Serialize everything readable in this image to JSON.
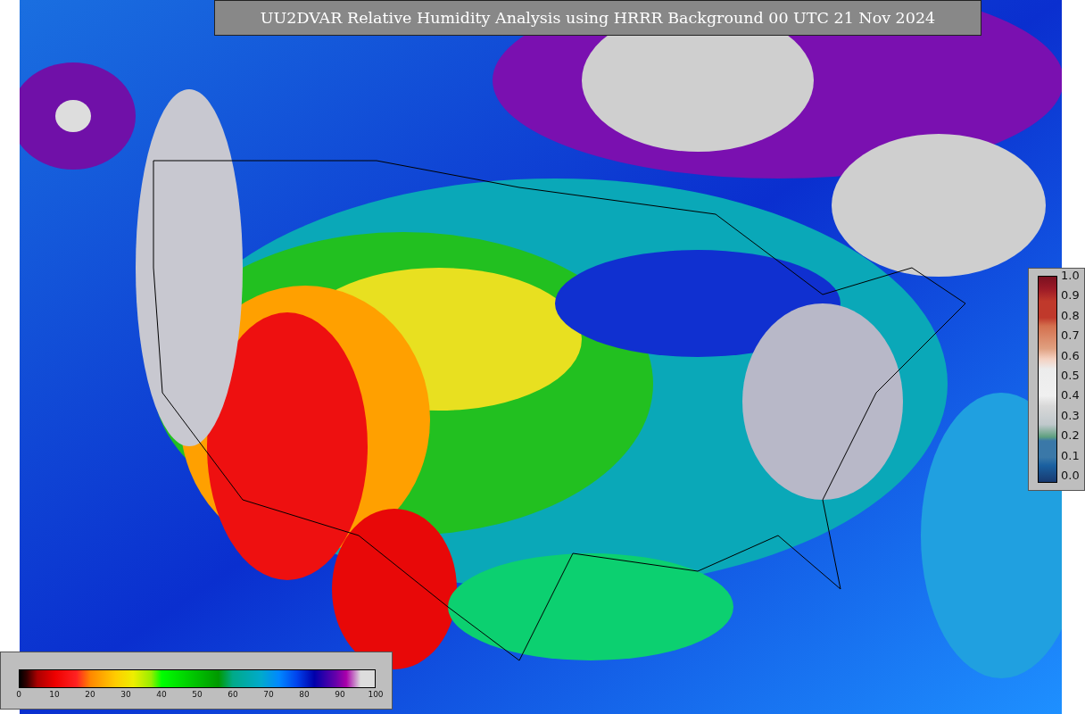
{
  "title": "UU2DVAR Relative Humidity Analysis using HRRR Background 00 UTC 21 Nov 2024",
  "station_colorbar": {
    "ticks": [
      "1.0",
      "0.9",
      "0.8",
      "0.7",
      "0.6",
      "0.5",
      "0.4",
      "0.3",
      "0.2",
      "0.1",
      "0.0"
    ]
  },
  "humidity_colorbar": {
    "ticks": [
      "0",
      "10",
      "20",
      "30",
      "40",
      "50",
      "60",
      "70",
      "80",
      "90",
      "100"
    ]
  }
}
